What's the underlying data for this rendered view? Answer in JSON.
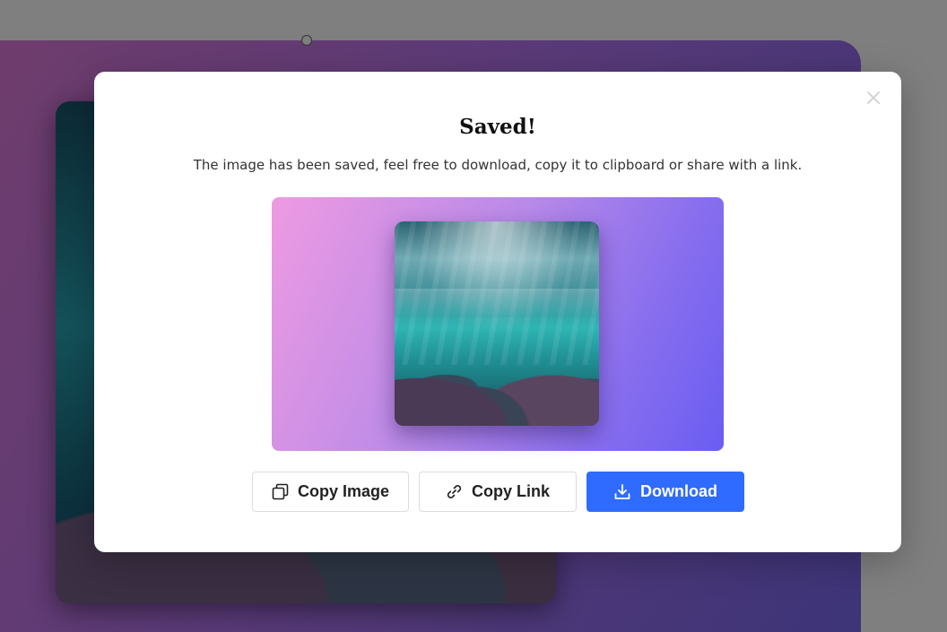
{
  "modal": {
    "title": "Saved!",
    "description": "The image has been saved, feel free to download, copy it to clipboard or share with a link.",
    "close_icon": "close-icon",
    "buttons": {
      "copy_image": {
        "label": "Copy Image",
        "icon": "copy-icon"
      },
      "copy_link": {
        "label": "Copy Link",
        "icon": "link-icon"
      },
      "download": {
        "label": "Download",
        "icon": "download-icon"
      }
    }
  },
  "colors": {
    "primary": "#2f6bff",
    "preview_gradient_start": "#ee9ae2",
    "preview_gradient_end": "#6a5df2",
    "backdrop": "#7f7f7f"
  }
}
